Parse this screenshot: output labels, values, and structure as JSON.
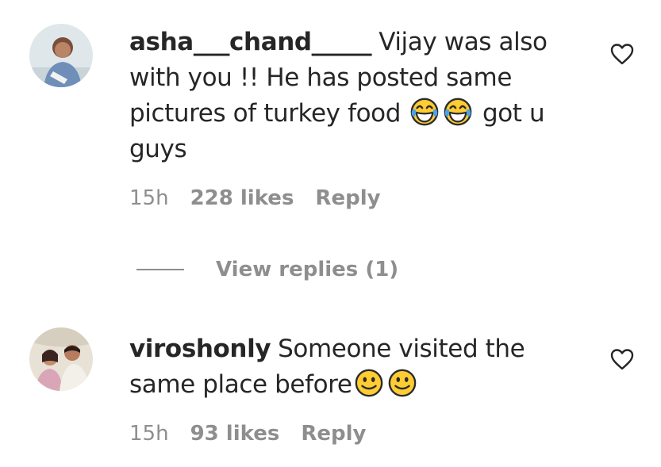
{
  "comments": [
    {
      "username": "asha___chand_____",
      "text_1": "Vijay was also with you !! He has posted same pictures of turkey food",
      "emoji_1": "face-with-tears-of-joy",
      "text_2": "got u guys",
      "time": "15h",
      "likes": "228 likes",
      "reply": "Reply"
    },
    {
      "username": "viroshonly",
      "text_1": "Someone visited the same place before",
      "emoji_1": "slightly-smiling-face",
      "time": "15h",
      "likes": "93 likes",
      "reply": "Reply"
    }
  ],
  "view_replies": "View replies (1)",
  "colors": {
    "text": "#262626",
    "secondary": "#8e8e8e",
    "emoji_yellow": "#ffcc33"
  }
}
